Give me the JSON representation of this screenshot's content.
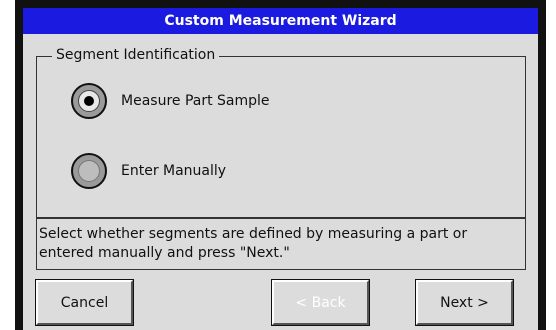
{
  "window": {
    "title": "Custom Measurement Wizard"
  },
  "group": {
    "legend": "Segment Identification",
    "options": [
      {
        "label": "Measure Part Sample",
        "selected": true
      },
      {
        "label": "Enter Manually",
        "selected": false
      }
    ]
  },
  "help": {
    "text": "Select whether segments are defined by measuring a part or entered manually and press \"Next.\""
  },
  "buttons": {
    "cancel": "Cancel",
    "back": "< Back",
    "next": "Next >"
  },
  "colors": {
    "titlebar": "#1a1ae0",
    "background": "#dcdcdc",
    "disabled_text": "#ffffff"
  }
}
